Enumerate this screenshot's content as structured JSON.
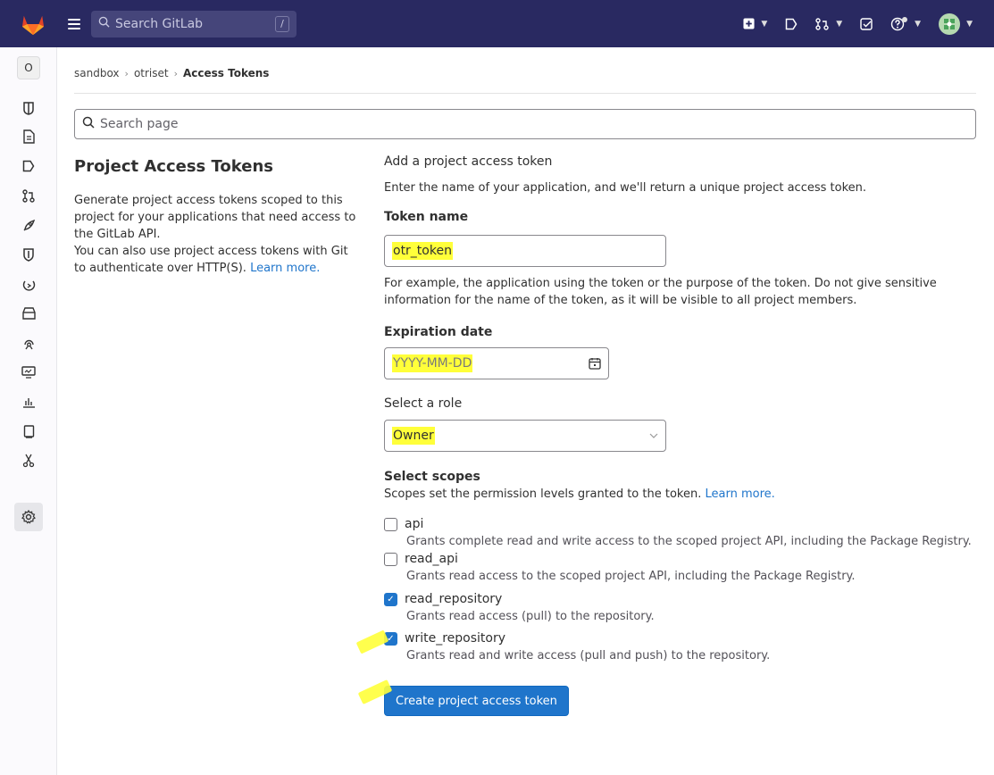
{
  "topbar": {
    "search_placeholder": "Search GitLab",
    "search_shortcut": "/"
  },
  "rail": {
    "project_initial": "O"
  },
  "breadcrumb": {
    "items": [
      "sandbox",
      "otriset",
      "Access Tokens"
    ]
  },
  "page_search": {
    "placeholder": "Search page"
  },
  "intro": {
    "title": "Project Access Tokens",
    "description_1": "Generate project access tokens scoped to this project for your applications that need access to the GitLab API.",
    "description_2": "You can also use project access tokens with Git to authenticate over HTTP(S).",
    "learn_more": "Learn more."
  },
  "form": {
    "section_title": "Add a project access token",
    "section_help": "Enter the name of your application, and we'll return a unique project access token.",
    "token_name_label": "Token name",
    "token_name_value": "otr_token",
    "token_name_help": "For example, the application using the token or the purpose of the token. Do not give sensitive information for the name of the token, as it will be visible to all project members.",
    "expiration_label": "Expiration date",
    "expiration_placeholder": "YYYY-MM-DD",
    "role_label": "Select a role",
    "role_value": "Owner",
    "scopes_label": "Select scopes",
    "scopes_help": "Scopes set the permission levels granted to the token.",
    "scopes_learn_more": "Learn more.",
    "scopes": [
      {
        "name": "api",
        "checked": false,
        "description": "Grants complete read and write access to the scoped project API, including the Package Registry."
      },
      {
        "name": "read_api",
        "checked": false,
        "description": "Grants read access to the scoped project API, including the Package Registry."
      },
      {
        "name": "read_repository",
        "checked": true,
        "description": "Grants read access (pull) to the repository."
      },
      {
        "name": "write_repository",
        "checked": true,
        "description": "Grants read and write access (pull and push) to the repository."
      }
    ],
    "submit_label": "Create project access token"
  },
  "colors": {
    "topbar": "#292961",
    "primary": "#1f75cb",
    "highlight": "#ffff3a"
  }
}
